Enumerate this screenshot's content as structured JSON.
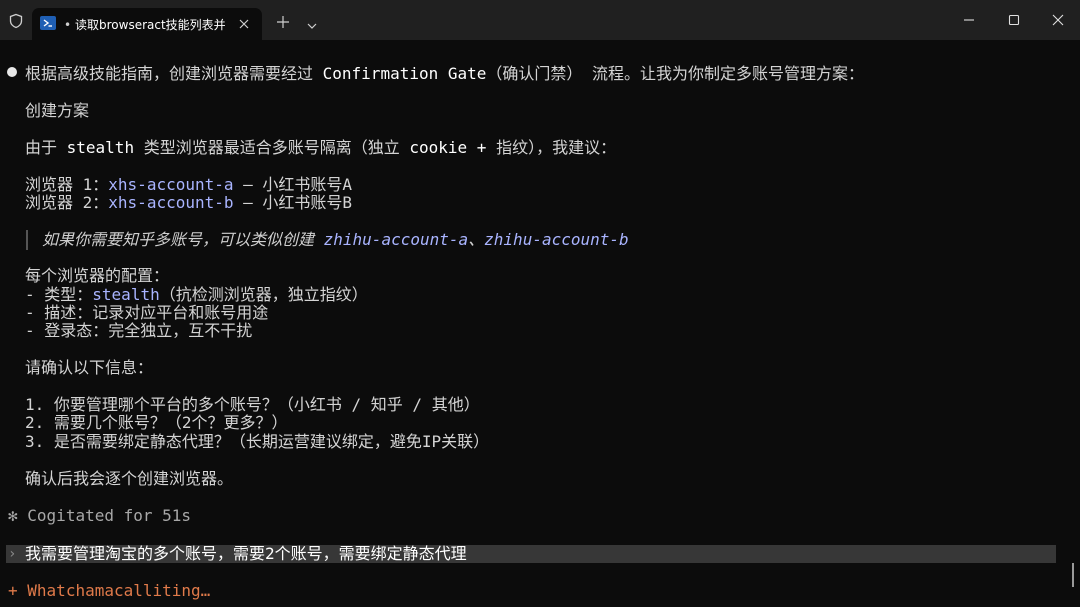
{
  "window": {
    "tab_title": "读取browseract技能列表并",
    "tab_dot": "•"
  },
  "terminal": {
    "intro": {
      "prefix": "根据高级技能指南，创建浏览器需要经过 ",
      "code": "Confirmation Gate",
      "suffix": "（确认门禁） 流程。让我为你制定多账号管理方案："
    },
    "heading_plan": "创建方案",
    "reason": {
      "prefix": "由于 ",
      "code": "stealth",
      "middle": " 类型浏览器最适合多账号隔离（独立 ",
      "code2": "cookie + ",
      "suffix": "指纹），我建议："
    },
    "browsers": [
      {
        "label": "浏览器 1：",
        "id": "xhs-account-a",
        "desc": " – 小红书账号A"
      },
      {
        "label": "浏览器 2：",
        "id": "xhs-account-b",
        "desc": " – 小红书账号B"
      }
    ],
    "quote": {
      "prefix": "如果你需要知乎多账号，可以类似创建 ",
      "id1": "zhihu-account-a",
      "sep": "、",
      "id2": "zhihu-account-b"
    },
    "config_heading": "每个浏览器的配置：",
    "config": {
      "type_prefix": "- 类型：",
      "type_value": "stealth",
      "type_suffix": "（抗检测浏览器，独立指纹）",
      "desc": "- 描述：记录对应平台和账号用途",
      "login": "- 登录态：完全独立，互不干扰"
    },
    "confirm_heading": "请确认以下信息：",
    "questions": [
      "1. 你要管理哪个平台的多个账号？（小红书 / 知乎 / 其他）",
      "2. 需要几个账号？（2个？更多？）",
      "3. 是否需要绑定静态代理？（长期运营建议绑定，避免IP关联）"
    ],
    "closing": "确认后我会逐个创建浏览器。",
    "cogitated": "Cogitated for 51s",
    "cogitated_glyph": "✻",
    "prompt_caret": "›",
    "user_input": "我需要管理淘宝的多个账号，需要2个账号，需要绑定静态代理",
    "thinking_glyph": "+",
    "thinking_text": "Whatchamacalliting…"
  },
  "icons": {
    "shield": "shield-icon",
    "powershell": "powershell-icon",
    "close_tab": "close-icon",
    "new_tab": "plus-icon",
    "dropdown": "chevron-down-icon",
    "minimize": "minimize-icon",
    "maximize": "maximize-icon",
    "close_window": "close-icon"
  },
  "colors": {
    "background": "#0c0c0c",
    "titlebar": "#202020",
    "accent": "#a9b4ff",
    "thinking": "#e07a4a"
  }
}
